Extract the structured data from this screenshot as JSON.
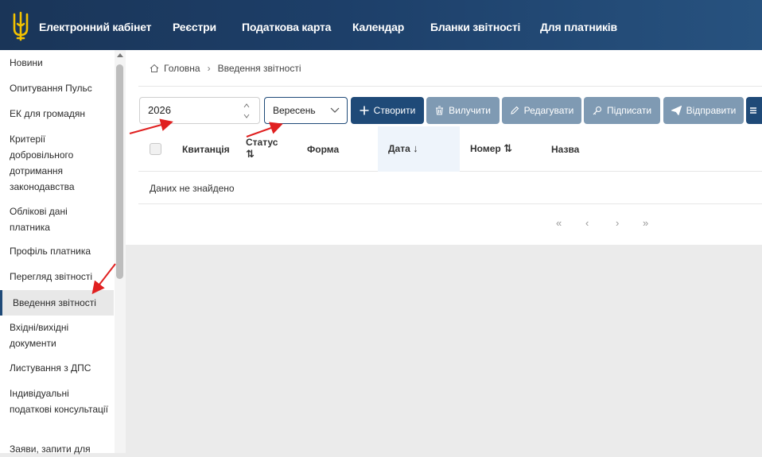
{
  "header": {
    "brand": "Електронний кабінет",
    "nav": [
      "Реєстри",
      "Податкова карта",
      "Календар",
      "Бланки звітності",
      "Для платників"
    ]
  },
  "sidebar": {
    "items": [
      "Новини",
      "Опитування Пульс",
      "ЕК для громадян",
      "Критерії добровільного дотримання законодавства",
      "Облікові дані платника",
      "Профіль платника",
      "Перегляд звітності",
      "Введення звітності",
      "Вхідні/вихідні документи",
      "Листування з ДПС",
      "Індивідуальні податкові консультації",
      "Заяви, запити для"
    ],
    "active_index": 7
  },
  "breadcrumb": {
    "home": "Головна",
    "current": "Введення звітності"
  },
  "filters": {
    "year": "2026",
    "month": "Вересень"
  },
  "toolbar": {
    "create": "Створити",
    "delete": "Вилучити",
    "edit": "Редагувати",
    "sign": "Підписати",
    "send": "Відправити"
  },
  "table": {
    "columns": [
      "Квитанція",
      "Статус",
      "Форма",
      "Дата",
      "Номер",
      "Назва"
    ],
    "empty": "Даних не знайдено"
  },
  "pagination": [
    "«",
    "‹",
    "›",
    "»"
  ],
  "colors": {
    "header": "#1d3f69",
    "primary": "#1f4a78",
    "muted": "#7f9ab3",
    "arrow": "#e02020"
  }
}
